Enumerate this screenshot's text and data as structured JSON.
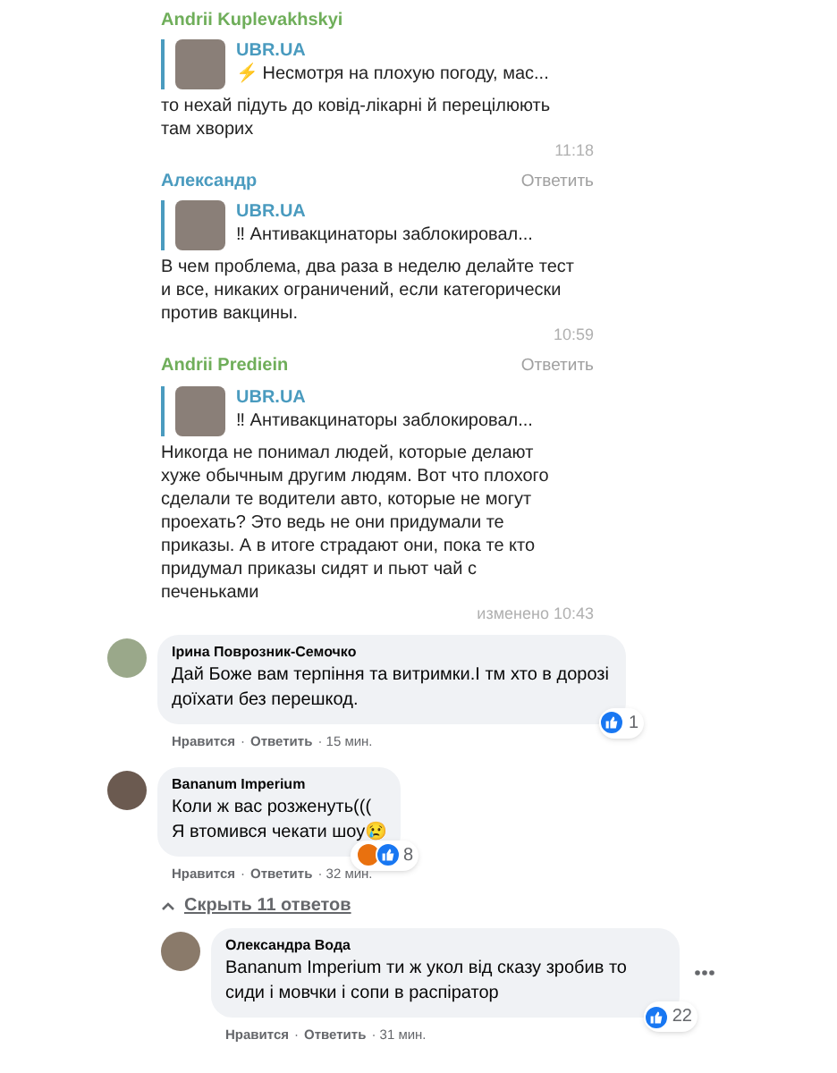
{
  "telegram_messages": [
    {
      "author": "Andrii Kuplevakhskyi",
      "quote": {
        "source": "UBR.UA",
        "text": "⚡ Несмотря на плохую погоду, мас..."
      },
      "body": "то нехай підуть до ковід-лікарні й перецілюють там хворих",
      "time": "11:18"
    },
    {
      "author": "Александр",
      "reply_action": "Ответить",
      "quote": {
        "source": "UBR.UA",
        "text": "‼ Антивакцинаторы заблокировал..."
      },
      "body": "В чем проблема, два раза в неделю делайте тест и все, никаких ограничений, если категорически против вакцины.",
      "time": "10:59"
    },
    {
      "author": "Andrii Prediein",
      "reply_action": "Ответить",
      "quote": {
        "source": "UBR.UA",
        "text": "‼ Антивакцинаторы заблокировал..."
      },
      "body": "Никогда не понимал людей, которые делают хуже обычным другим людям. Вот что плохого сделали те водители авто, которые не могут проехать? Это ведь не они придумали те приказы. А в итоге страдают они, пока те кто придумал приказы сидят и пьют чай с печеньками",
      "time": "изменено 10:43"
    }
  ],
  "comments": [
    {
      "author": "Ірина Поврозник-Семочко",
      "text": "Дай Боже вам терпіння та витримки.І тм хто в дорозі доїхати без перешкод.",
      "reactions": [
        {
          "kind": "like"
        }
      ],
      "reaction_count": "1",
      "actions": [
        "Нравится",
        "·",
        "Ответить",
        "· 15 мин."
      ]
    },
    {
      "author": "Bananum Imperium",
      "text": "Коли ж вас розженуть(((\nЯ втомився чекати шоу😢",
      "reactions": [
        {
          "kind": "angry"
        },
        {
          "kind": "like"
        }
      ],
      "reaction_count": "8",
      "actions": [
        "Нравится",
        "·",
        "Ответить",
        "· 32 мин."
      ],
      "replies_toggle": {
        "label": "Скрыть 11 ответов",
        "expanded": true
      },
      "replies": [
        {
          "author": "Олександра Вода",
          "text": "Bananum Imperium ти ж укол від сказу зробив то сиди і мовчки і сопи в распіратор",
          "reactions": [
            {
              "kind": "like"
            }
          ],
          "reaction_count": "22",
          "actions": [
            "Нравится",
            "·",
            "Ответить",
            "· 31 мин."
          ]
        }
      ]
    }
  ]
}
